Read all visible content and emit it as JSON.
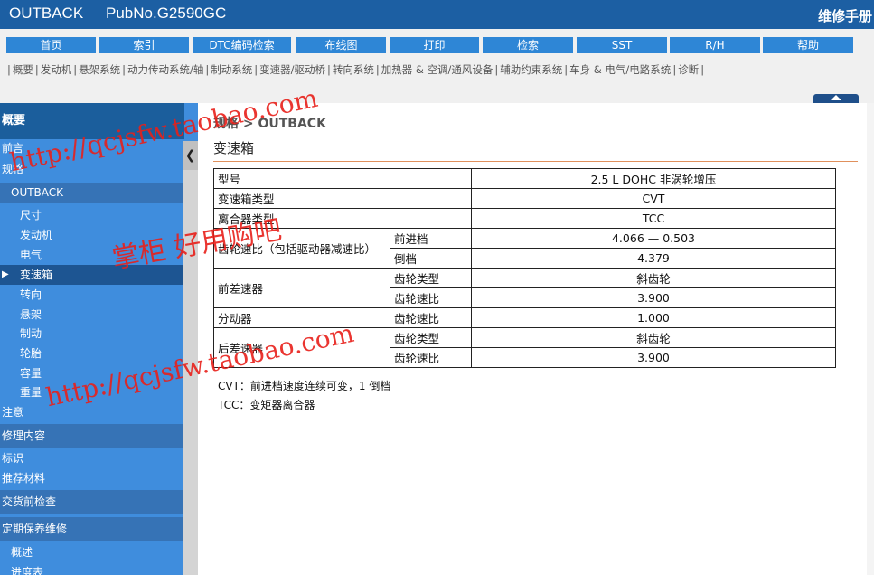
{
  "header": {
    "app_title": "OUTBACK",
    "pub_no": "PubNo.G2590GC",
    "manual_label": "维修手册"
  },
  "nav": {
    "buttons": [
      "首页",
      "索引",
      "DTC编码检索",
      "布线图",
      "打印",
      "检索",
      "SST",
      "R/H",
      "帮助"
    ],
    "categories": [
      "概要",
      "发动机",
      "悬架系统",
      "动力传动系统/轴",
      "制动系统",
      "变速器/驱动桥",
      "转向系统",
      "加热器 & 空调/通风设备",
      "辅助约束系统",
      "车身 & 电气/电路系统",
      "诊断"
    ]
  },
  "sidebar": {
    "header": "概要",
    "items": [
      "前言",
      "规格",
      "OUTBACK",
      "尺寸",
      "发动机",
      "电气",
      "变速箱",
      "转向",
      "悬架",
      "制动",
      "轮胎",
      "容量",
      "重量",
      "注意",
      "修理内容",
      "标识",
      "推荐材料",
      "交货前检查",
      "定期保养维修",
      "概述",
      "进度表"
    ],
    "selected": "变速箱",
    "collapse_glyph": "❮"
  },
  "content": {
    "breadcrumb": "规格 > OUTBACK",
    "section_title": "变速箱",
    "table": [
      [
        "型号",
        "",
        "2.5 L DOHC 非涡轮增压"
      ],
      [
        "变速箱类型",
        "",
        "CVT"
      ],
      [
        "离合器类型",
        "",
        "TCC"
      ],
      [
        "齿轮速比（包括驱动器减速比）",
        "前进档",
        "4.066 — 0.503"
      ],
      [
        "",
        "倒档",
        "4.379"
      ],
      [
        "前差速器",
        "齿轮类型",
        "斜齿轮"
      ],
      [
        "",
        "齿轮速比",
        "3.900"
      ],
      [
        "分动器",
        "齿轮速比",
        "1.000"
      ],
      [
        "后差速器",
        "齿轮类型",
        "斜齿轮"
      ],
      [
        "",
        "齿轮速比",
        "3.900"
      ]
    ],
    "notes": [
      "CVT：前进档速度连续可变，1 倒档",
      "TCC：变矩器离合器"
    ]
  },
  "watermarks": [
    "http://qcjsfw.taobao.com",
    "掌柜 好用购吧",
    "http://qcjsfw.taobao.com"
  ]
}
